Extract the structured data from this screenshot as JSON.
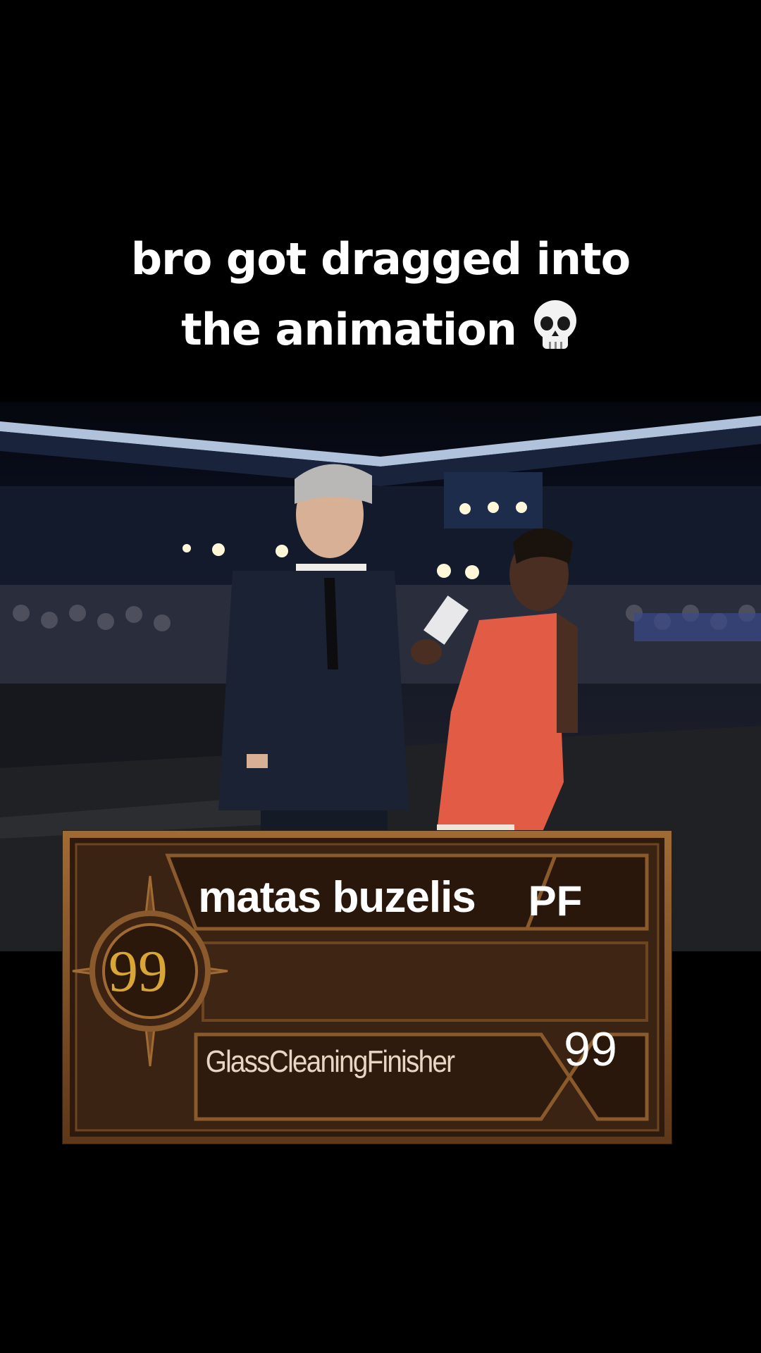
{
  "caption": {
    "line1": "bro got dragged into",
    "line2": "the animation",
    "emoji": "skull-icon"
  },
  "card": {
    "player_name": "matas buzelis",
    "position": "PF",
    "overall": "99",
    "badge_name": "GlassCleaningFinisher",
    "badge_rating": "99"
  },
  "colors": {
    "card_bg": "#3b2414",
    "card_frame": "#8a5a2c",
    "overall_text": "#d9a636",
    "dress": "#e05a45"
  }
}
